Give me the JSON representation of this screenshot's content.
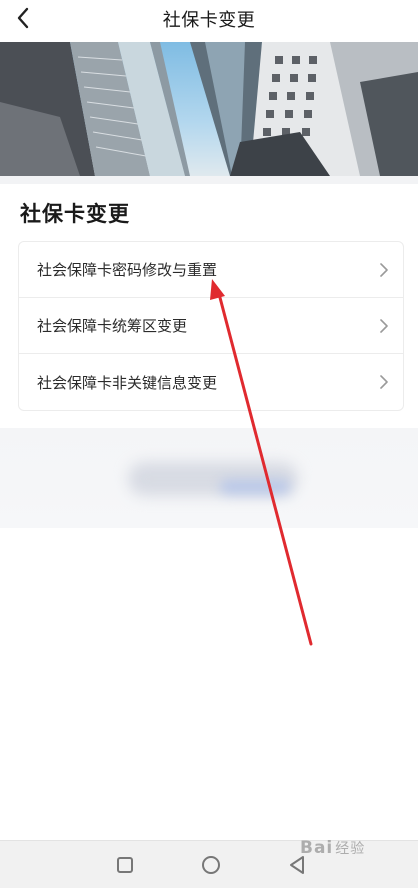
{
  "header": {
    "title": "社保卡变更",
    "back_icon": "chevron-left-icon"
  },
  "banner": {
    "description_icon": "city-buildings-image"
  },
  "section": {
    "title": "社保卡变更"
  },
  "menu": {
    "items": [
      {
        "label": "社会保障卡密码修改与重置",
        "icon": "chevron-right-icon"
      },
      {
        "label": "社会保障卡统筹区变更",
        "icon": "chevron-right-icon"
      },
      {
        "label": "社会保障卡非关键信息变更",
        "icon": "chevron-right-icon"
      }
    ]
  },
  "annotation": {
    "color": "#e02a2f",
    "icon": "red-arrow-annotation"
  },
  "navbar": {
    "icons": [
      "recent-apps-icon",
      "home-icon",
      "back-triangle-icon"
    ]
  },
  "watermark": {
    "text": "Bai",
    "suffix": "经验"
  }
}
